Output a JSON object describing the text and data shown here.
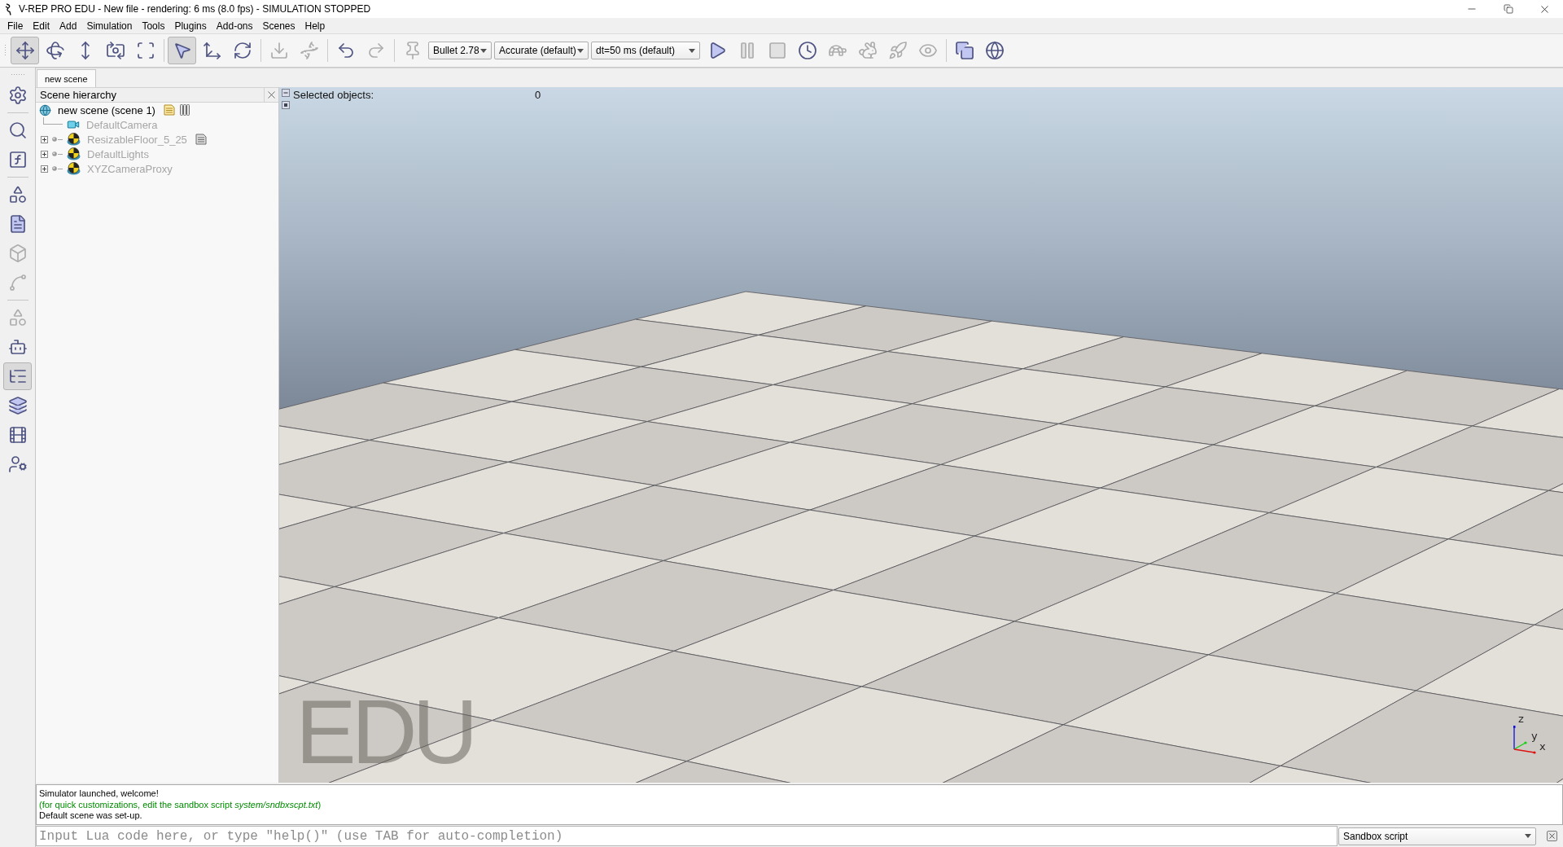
{
  "window": {
    "title": "V-REP PRO EDU - New file - rendering: 6 ms (8.0 fps) - SIMULATION STOPPED"
  },
  "menu": [
    "File",
    "Edit",
    "Add",
    "Simulation",
    "Tools",
    "Plugins",
    "Add-ons",
    "Scenes",
    "Help"
  ],
  "toolbar": {
    "buttons": [
      {
        "selected": true,
        "disabled": false
      },
      {
        "selected": false,
        "disabled": false
      },
      {
        "selected": false,
        "disabled": false
      },
      {
        "selected": false,
        "disabled": false
      },
      {
        "selected": false,
        "disabled": false
      },
      {
        "selected": true,
        "disabled": false
      },
      {
        "selected": false,
        "disabled": false
      },
      {
        "selected": false,
        "disabled": false
      },
      {
        "selected": false,
        "disabled": true
      },
      {
        "selected": false,
        "disabled": true
      },
      {
        "selected": false,
        "disabled": false
      },
      {
        "selected": false,
        "disabled": true
      },
      {
        "selected": false,
        "disabled": true
      },
      {
        "selected": false,
        "disabled": false
      },
      {
        "selected": false,
        "disabled": true
      },
      {
        "selected": false,
        "disabled": true
      },
      {
        "selected": false,
        "disabled": false
      },
      {
        "selected": false,
        "disabled": true
      },
      {
        "selected": false,
        "disabled": true
      },
      {
        "selected": false,
        "disabled": true
      },
      {
        "selected": false,
        "disabled": true
      },
      {
        "selected": false,
        "disabled": false
      },
      {
        "selected": false,
        "disabled": false
      }
    ],
    "engine": "Bullet 2.78",
    "accuracy": "Accurate (default)",
    "time_step": "dt=50 ms (default)"
  },
  "sidebar": {
    "buttons": [
      {
        "selected": false,
        "disabled": false
      },
      {
        "selected": false,
        "disabled": false
      },
      {
        "selected": false,
        "disabled": false
      },
      {
        "selected": false,
        "disabled": false
      },
      {
        "selected": false,
        "disabled": false
      },
      {
        "selected": false,
        "disabled": true
      },
      {
        "selected": false,
        "disabled": true
      },
      {
        "selected": false,
        "disabled": true
      },
      {
        "selected": false,
        "disabled": false
      },
      {
        "selected": true,
        "disabled": false
      },
      {
        "selected": false,
        "disabled": false
      },
      {
        "selected": false,
        "disabled": false
      },
      {
        "selected": false,
        "disabled": false
      }
    ]
  },
  "tabs": [
    {
      "label": "new scene",
      "selected": true
    }
  ],
  "scene_hierarchy": {
    "title": "Scene hierarchy",
    "root": {
      "label": "new scene (scene 1)",
      "children": [
        {
          "label": "DefaultCamera",
          "kind": "camera",
          "collapsed": false,
          "script": false,
          "dimmed": true
        },
        {
          "label": "ResizableFloor_5_25",
          "kind": "model",
          "collapsed": true,
          "script": true,
          "dimmed": true
        },
        {
          "label": "DefaultLights",
          "kind": "model",
          "collapsed": true,
          "script": false,
          "dimmed": true
        },
        {
          "label": "XYZCameraProxy",
          "kind": "model",
          "collapsed": true,
          "script": false,
          "dimmed": true
        }
      ]
    }
  },
  "viewport": {
    "selected_objects_label": "Selected objects:",
    "selected_objects_count": "0",
    "edition_mark": "EDU",
    "axes": [
      "z",
      "y",
      "x"
    ]
  },
  "console": {
    "lines": [
      {
        "text": "Simulator launched, welcome!",
        "kind": "message"
      },
      {
        "text": "(for quick customizations, edit the sandbox script *system/sndbxscpt.txt*)",
        "kind": "hint"
      },
      {
        "text": "Default scene was set-up.",
        "kind": "message"
      }
    ],
    "input_placeholder": "Input Lua code here, or type \"help()\" (use TAB for auto-completion)",
    "script_select": "Sandbox script"
  }
}
